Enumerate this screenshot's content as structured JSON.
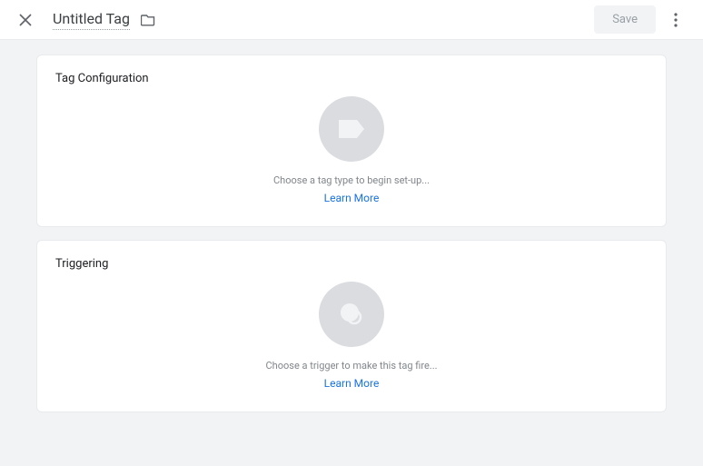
{
  "header": {
    "title": "Untitled Tag",
    "save_label": "Save"
  },
  "cards": {
    "tag_config": {
      "title": "Tag Configuration",
      "hint": "Choose a tag type to begin set-up...",
      "learn_more": "Learn More"
    },
    "triggering": {
      "title": "Triggering",
      "hint": "Choose a trigger to make this tag fire...",
      "learn_more": "Learn More"
    }
  }
}
